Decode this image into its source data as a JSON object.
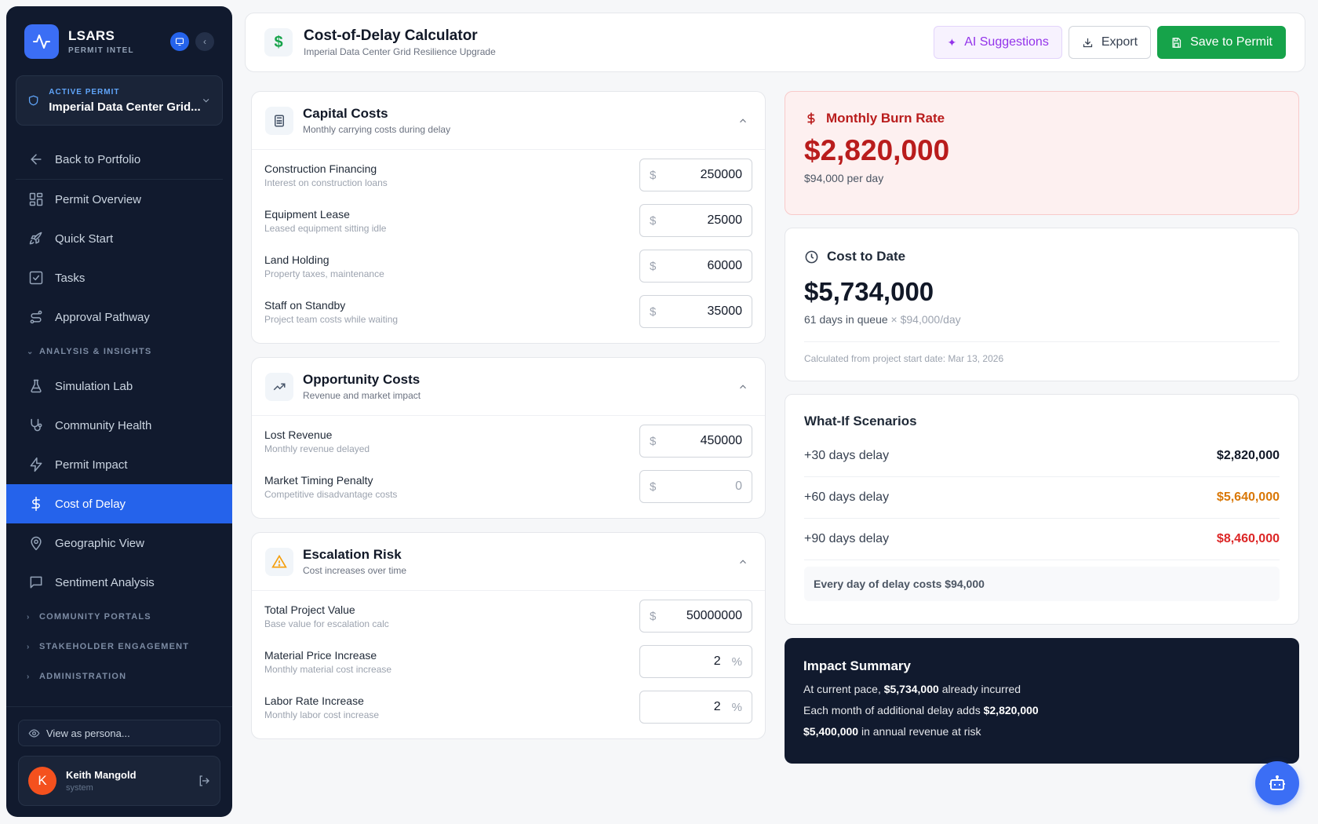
{
  "app": {
    "name": "LSARS",
    "subtitle": "PERMIT INTEL"
  },
  "permit": {
    "label": "ACTIVE PERMIT",
    "name": "Imperial Data Center Grid..."
  },
  "nav": {
    "back": "Back to Portfolio",
    "items": [
      {
        "label": "Permit Overview",
        "icon": "grid-icon"
      },
      {
        "label": "Quick Start",
        "icon": "rocket-icon"
      },
      {
        "label": "Tasks",
        "icon": "checkbox-icon"
      },
      {
        "label": "Approval Pathway",
        "icon": "route-icon"
      }
    ],
    "section_analysis": "ANALYSIS & INSIGHTS",
    "analysis_items": [
      {
        "label": "Simulation Lab",
        "icon": "flask-icon"
      },
      {
        "label": "Community Health",
        "icon": "stethoscope-icon"
      },
      {
        "label": "Permit Impact",
        "icon": "bolt-icon"
      },
      {
        "label": "Cost of Delay",
        "icon": "dollar-icon",
        "active": true
      },
      {
        "label": "Geographic View",
        "icon": "map-pin-icon"
      },
      {
        "label": "Sentiment Analysis",
        "icon": "chat-icon"
      }
    ],
    "section_portals": "COMMUNITY PORTALS",
    "section_stakeholder": "STAKEHOLDER ENGAGEMENT",
    "section_admin": "ADMINISTRATION"
  },
  "persona": {
    "label": "View as persona..."
  },
  "user": {
    "initial": "K",
    "name": "Keith Mangold",
    "role": "system"
  },
  "header": {
    "title": "Cost-of-Delay Calculator",
    "subtitle": "Imperial Data Center Grid Resilience Upgrade",
    "ai_label": "AI Suggestions",
    "export_label": "Export",
    "save_label": "Save to Permit"
  },
  "capital": {
    "title": "Capital Costs",
    "subtitle": "Monthly carrying costs during delay",
    "fields": [
      {
        "label": "Construction Financing",
        "help": "Interest on construction loans",
        "prefix": "$",
        "value": "250000"
      },
      {
        "label": "Equipment Lease",
        "help": "Leased equipment sitting idle",
        "prefix": "$",
        "value": "25000"
      },
      {
        "label": "Land Holding",
        "help": "Property taxes, maintenance",
        "prefix": "$",
        "value": "60000"
      },
      {
        "label": "Staff on Standby",
        "help": "Project team costs while waiting",
        "prefix": "$",
        "value": "35000"
      }
    ]
  },
  "opportunity": {
    "title": "Opportunity Costs",
    "subtitle": "Revenue and market impact",
    "fields": [
      {
        "label": "Lost Revenue",
        "help": "Monthly revenue delayed",
        "prefix": "$",
        "value": "450000"
      },
      {
        "label": "Market Timing Penalty",
        "help": "Competitive disadvantage costs",
        "prefix": "$",
        "placeholder": "0"
      }
    ]
  },
  "escalation": {
    "title": "Escalation Risk",
    "subtitle": "Cost increases over time",
    "fields": [
      {
        "label": "Total Project Value",
        "help": "Base value for escalation calc",
        "prefix": "$",
        "value": "50000000"
      },
      {
        "label": "Material Price Increase",
        "help": "Monthly material cost increase",
        "suffix": "%",
        "value": "2"
      },
      {
        "label": "Labor Rate Increase",
        "help": "Monthly labor cost increase",
        "suffix": "%",
        "value": "2"
      }
    ]
  },
  "burn": {
    "title": "Monthly Burn Rate",
    "amount": "$2,820,000",
    "per_day": "$94,000 per day"
  },
  "cost_to_date": {
    "title": "Cost to Date",
    "amount": "$5,734,000",
    "days": "61 days in queue",
    "rate": "× $94,000/day",
    "footnote": "Calculated from project start date: Mar 13, 2026"
  },
  "whatif": {
    "title": "What-If Scenarios",
    "rows": [
      {
        "label": "+30 days delay",
        "amount": "$2,820,000",
        "color": "#111827"
      },
      {
        "label": "+60 days delay",
        "amount": "$5,640,000",
        "color": "#d97706"
      },
      {
        "label": "+90 days delay",
        "amount": "$8,460,000",
        "color": "#dc2626"
      }
    ],
    "note": "Every day of delay costs $94,000"
  },
  "impact": {
    "title": "Impact Summary",
    "l1_pre": "At current pace,",
    "l1_bold": "$5,734,000",
    "l1_post": "already incurred",
    "l2_pre": "Each month of additional delay adds",
    "l2_bold": "$2,820,000",
    "l3_bold": "$5,400,000",
    "l3_post": "in annual revenue at risk"
  },
  "colors": {
    "accent": "#2563eb",
    "success": "#16a34a",
    "danger": "#b91c1c",
    "sidebar": "#111a2e"
  }
}
